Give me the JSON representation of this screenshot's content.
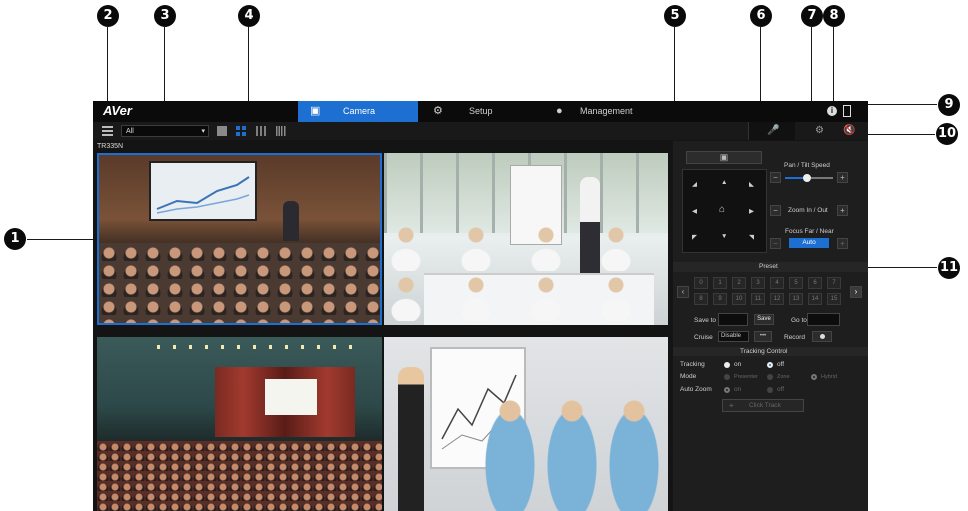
{
  "callouts": [
    "1",
    "2",
    "3",
    "4",
    "5",
    "6",
    "7",
    "8",
    "9",
    "10",
    "11"
  ],
  "app": {
    "logo": "AVer",
    "tabs": [
      {
        "label": "Camera",
        "icon": "camera-icon",
        "active": true
      },
      {
        "label": "Setup",
        "icon": "gear-icon",
        "active": false
      },
      {
        "label": "Management",
        "icon": "user-icon",
        "active": false
      }
    ],
    "toolbar": {
      "group_select": "All"
    },
    "camera_name": "TR335N",
    "accent": "#1d6fd2"
  },
  "panel": {
    "pan_tilt_label": "Pan / Tilt Speed",
    "pan_tilt_speed": 0.45,
    "zoom_label": "Zoom In / Out",
    "focus_label": "Focus Far / Near",
    "auto_label": "Auto",
    "preset_title": "Preset",
    "preset_numbers": [
      "0",
      "1",
      "2",
      "3",
      "4",
      "5",
      "6",
      "7",
      "8",
      "9",
      "10",
      "11",
      "12",
      "13",
      "14",
      "15"
    ],
    "save_to_label": "Save to",
    "save_label": "Save",
    "go_to_label": "Go to",
    "cruise_label": "Cruise",
    "cruise_value": "Disable",
    "cruise_more": "•••",
    "record_label": "Record",
    "tracking_title": "Tracking Control",
    "tracking_label": "Tracking",
    "on_label": "on",
    "off_label": "off",
    "mode_label": "Mode",
    "mode_presenter": "Presenter",
    "mode_zone": "Zone",
    "mode_hybrid": "Hybrid",
    "auto_zoom_label": "Auto Zoom",
    "click_track": "Click Track"
  }
}
